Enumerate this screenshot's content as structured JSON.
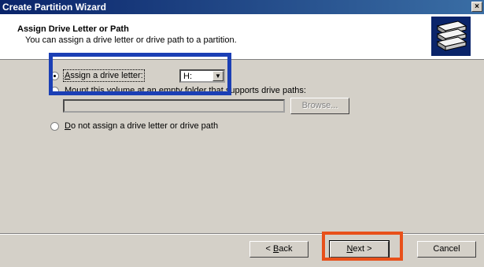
{
  "window": {
    "title": "Create Partition Wizard",
    "close_glyph": "×"
  },
  "header": {
    "title": "Assign Drive Letter or Path",
    "subtitle": "You can assign a drive letter or drive path to a partition.",
    "icon": "disk-stack-icon"
  },
  "options": {
    "assign_letter": {
      "label": "Assign a drive letter:",
      "accel": "A",
      "rest": "ssign a drive letter:",
      "checked": true
    },
    "drive_letter": {
      "value": "H:"
    },
    "mount_folder": {
      "label": "Mount this volume at an empty folder that supports drive paths:",
      "accel": "M",
      "rest": "ount this volume at an empty folder that supports drive paths:",
      "checked": false
    },
    "browse": {
      "label": "Browse..."
    },
    "no_assign": {
      "label": "Do not assign a drive letter or drive path",
      "accel": "D",
      "rest": "o not assign a drive letter or drive path",
      "checked": false
    }
  },
  "footer": {
    "back": {
      "accel": "B",
      "prefix": "< ",
      "rest": "ack"
    },
    "next": {
      "accel": "N",
      "rest": "ext",
      "suffix": " >"
    },
    "cancel": "Cancel"
  },
  "highlights": {
    "blue": "#1b3fb5",
    "orange": "#e8501a"
  }
}
